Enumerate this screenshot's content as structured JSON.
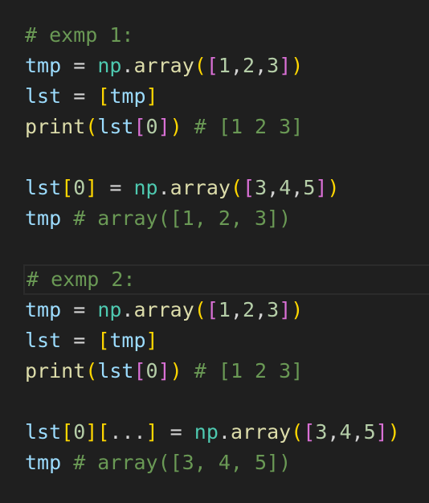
{
  "editor": {
    "lines": [
      [
        {
          "t": "# exmp 1:",
          "c": "comment"
        }
      ],
      [
        {
          "t": "tmp",
          "c": "var"
        },
        {
          "t": " = ",
          "c": "op"
        },
        {
          "t": "np",
          "c": "mod"
        },
        {
          "t": ".",
          "c": "op"
        },
        {
          "t": "array",
          "c": "fn"
        },
        {
          "t": "(",
          "c": "b1"
        },
        {
          "t": "[",
          "c": "b2"
        },
        {
          "t": "1",
          "c": "num"
        },
        {
          "t": ",",
          "c": "op"
        },
        {
          "t": "2",
          "c": "num"
        },
        {
          "t": ",",
          "c": "op"
        },
        {
          "t": "3",
          "c": "num"
        },
        {
          "t": "]",
          "c": "b2"
        },
        {
          "t": ")",
          "c": "b1"
        }
      ],
      [
        {
          "t": "lst",
          "c": "var"
        },
        {
          "t": " = ",
          "c": "op"
        },
        {
          "t": "[",
          "c": "b1"
        },
        {
          "t": "tmp",
          "c": "var"
        },
        {
          "t": "]",
          "c": "b1"
        }
      ],
      [
        {
          "t": "print",
          "c": "fn"
        },
        {
          "t": "(",
          "c": "b1"
        },
        {
          "t": "lst",
          "c": "var"
        },
        {
          "t": "[",
          "c": "b2"
        },
        {
          "t": "0",
          "c": "num"
        },
        {
          "t": "]",
          "c": "b2"
        },
        {
          "t": ")",
          "c": "b1"
        },
        {
          "t": " # [1 2 3]",
          "c": "comment"
        }
      ],
      [],
      [
        {
          "t": "lst",
          "c": "var"
        },
        {
          "t": "[",
          "c": "b1"
        },
        {
          "t": "0",
          "c": "num"
        },
        {
          "t": "]",
          "c": "b1"
        },
        {
          "t": " = ",
          "c": "op"
        },
        {
          "t": "np",
          "c": "mod"
        },
        {
          "t": ".",
          "c": "op"
        },
        {
          "t": "array",
          "c": "fn"
        },
        {
          "t": "(",
          "c": "b1"
        },
        {
          "t": "[",
          "c": "b2"
        },
        {
          "t": "3",
          "c": "num"
        },
        {
          "t": ",",
          "c": "op"
        },
        {
          "t": "4",
          "c": "num"
        },
        {
          "t": ",",
          "c": "op"
        },
        {
          "t": "5",
          "c": "num"
        },
        {
          "t": "]",
          "c": "b2"
        },
        {
          "t": ")",
          "c": "b1"
        }
      ],
      [
        {
          "t": "tmp",
          "c": "var"
        },
        {
          "t": " # array([1, 2, 3])",
          "c": "comment"
        }
      ],
      [],
      [
        {
          "t": "# exmp 2:",
          "c": "comment"
        }
      ],
      [
        {
          "t": "tmp",
          "c": "var"
        },
        {
          "t": " = ",
          "c": "op"
        },
        {
          "t": "np",
          "c": "mod"
        },
        {
          "t": ".",
          "c": "op"
        },
        {
          "t": "array",
          "c": "fn"
        },
        {
          "t": "(",
          "c": "b1"
        },
        {
          "t": "[",
          "c": "b2"
        },
        {
          "t": "1",
          "c": "num"
        },
        {
          "t": ",",
          "c": "op"
        },
        {
          "t": "2",
          "c": "num"
        },
        {
          "t": ",",
          "c": "op"
        },
        {
          "t": "3",
          "c": "num"
        },
        {
          "t": "]",
          "c": "b2"
        },
        {
          "t": ")",
          "c": "b1"
        }
      ],
      [
        {
          "t": "lst",
          "c": "var"
        },
        {
          "t": " = ",
          "c": "op"
        },
        {
          "t": "[",
          "c": "b1"
        },
        {
          "t": "tmp",
          "c": "var"
        },
        {
          "t": "]",
          "c": "b1"
        }
      ],
      [
        {
          "t": "print",
          "c": "fn"
        },
        {
          "t": "(",
          "c": "b1"
        },
        {
          "t": "lst",
          "c": "var"
        },
        {
          "t": "[",
          "c": "b2"
        },
        {
          "t": "0",
          "c": "num"
        },
        {
          "t": "]",
          "c": "b2"
        },
        {
          "t": ")",
          "c": "b1"
        },
        {
          "t": " # [1 2 3]",
          "c": "comment"
        }
      ],
      [],
      [
        {
          "t": "lst",
          "c": "var"
        },
        {
          "t": "[",
          "c": "b1"
        },
        {
          "t": "0",
          "c": "num"
        },
        {
          "t": "]",
          "c": "b1"
        },
        {
          "t": "[",
          "c": "b1"
        },
        {
          "t": "...",
          "c": "op"
        },
        {
          "t": "]",
          "c": "b1"
        },
        {
          "t": " = ",
          "c": "op"
        },
        {
          "t": "np",
          "c": "mod"
        },
        {
          "t": ".",
          "c": "op"
        },
        {
          "t": "array",
          "c": "fn"
        },
        {
          "t": "(",
          "c": "b1"
        },
        {
          "t": "[",
          "c": "b2"
        },
        {
          "t": "3",
          "c": "num"
        },
        {
          "t": ",",
          "c": "op"
        },
        {
          "t": "4",
          "c": "num"
        },
        {
          "t": ",",
          "c": "op"
        },
        {
          "t": "5",
          "c": "num"
        },
        {
          "t": "]",
          "c": "b2"
        },
        {
          "t": ")",
          "c": "b1"
        }
      ],
      [
        {
          "t": "tmp",
          "c": "var"
        },
        {
          "t": " # array([3, 4, 5])",
          "c": "comment"
        }
      ]
    ],
    "highlight_line": 8
  },
  "colors": {
    "background": "#1f1f1f",
    "comment": "#6a9955",
    "variable": "#9cdcfe",
    "module": "#4ec9b0",
    "function": "#dcdcaa",
    "number": "#b5cea8",
    "bracket_level1": "#ffd700",
    "bracket_level2": "#da70d6"
  }
}
